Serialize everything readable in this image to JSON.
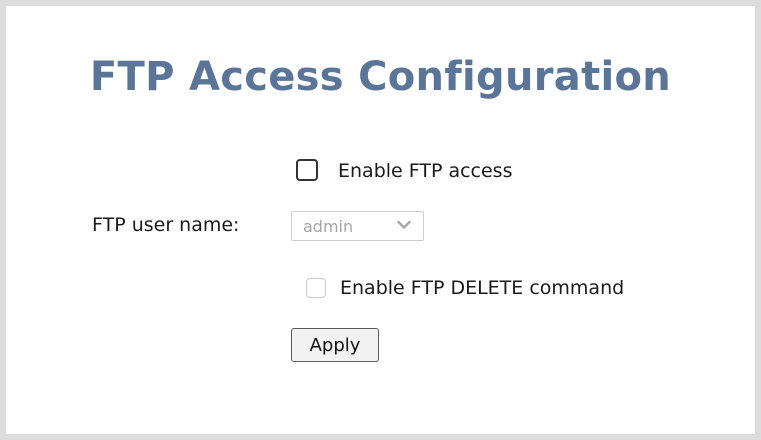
{
  "page": {
    "title": "FTP Access Configuration"
  },
  "form": {
    "enable_ftp": {
      "label": "Enable FTP access",
      "checked": false
    },
    "user_name": {
      "label": "FTP user name:",
      "selected_value": "admin",
      "disabled": true
    },
    "enable_delete": {
      "label": "Enable FTP DELETE command",
      "checked": false,
      "disabled": true
    },
    "apply_label": "Apply"
  },
  "colors": {
    "title": "#5b7599",
    "frame_border": "#dcdcdc",
    "disabled_text": "#a5a5a5"
  },
  "icons": {
    "select_arrow": "chevron-down-icon"
  }
}
